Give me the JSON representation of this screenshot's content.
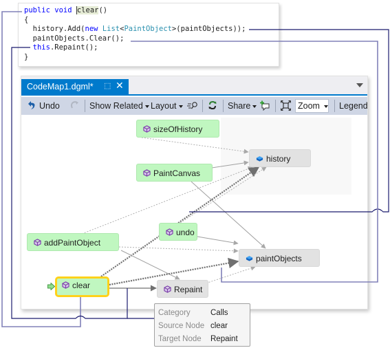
{
  "code": {
    "lines": [
      {
        "segments": [
          {
            "text": "public void ",
            "cls": "kw"
          },
          {
            "text": "clear",
            "cls": "hl"
          },
          {
            "text": "()",
            "cls": ""
          }
        ]
      },
      {
        "segments": [
          {
            "text": "{",
            "cls": ""
          }
        ]
      },
      {
        "segments": [
          {
            "text": "  history.Add(",
            "cls": ""
          },
          {
            "text": "new",
            "cls": "kw"
          },
          {
            "text": " ",
            "cls": ""
          },
          {
            "text": "List",
            "cls": "ty"
          },
          {
            "text": "<",
            "cls": ""
          },
          {
            "text": "PaintObject",
            "cls": "ty"
          },
          {
            "text": ">(paintObjects));",
            "cls": ""
          }
        ]
      },
      {
        "segments": [
          {
            "text": "  paintObjects.Clear();",
            "cls": ""
          }
        ]
      },
      {
        "segments": [
          {
            "text": "  ",
            "cls": ""
          },
          {
            "text": "this",
            "cls": "kw"
          },
          {
            "text": ".Repaint();",
            "cls": ""
          }
        ]
      },
      {
        "segments": [
          {
            "text": "}",
            "cls": ""
          }
        ]
      }
    ]
  },
  "window": {
    "tab_title": "CodeMap1.dgml*",
    "pin_icon": "pin-icon",
    "close_icon": "close-icon"
  },
  "toolbar": {
    "undo_label": "Undo",
    "show_related_label": "Show Related",
    "layout_label": "Layout",
    "share_label": "Share",
    "zoom_value": "Zoom",
    "legend_label": "Legend"
  },
  "nodes": {
    "sizeOfHistory": "sizeOfHistory",
    "history": "history",
    "PaintCanvas": "PaintCanvas",
    "undo": "undo",
    "addPaintObject": "addPaintObject",
    "paintObjects": "paintObjects",
    "clear": "clear",
    "Repaint": "Repaint"
  },
  "tooltip": {
    "rows": [
      {
        "key": "Category",
        "value": "Calls"
      },
      {
        "key": "Source Node",
        "value": "clear"
      },
      {
        "key": "Target Node",
        "value": "Repaint"
      }
    ]
  },
  "colors": {
    "accent": "#007acc",
    "method_node": "#c0f7c0",
    "field_node": "#e2e2e2",
    "selected_border": "#ffd11a",
    "callout_dark": "#1a1a6e",
    "callout_light": "#8080b8"
  }
}
